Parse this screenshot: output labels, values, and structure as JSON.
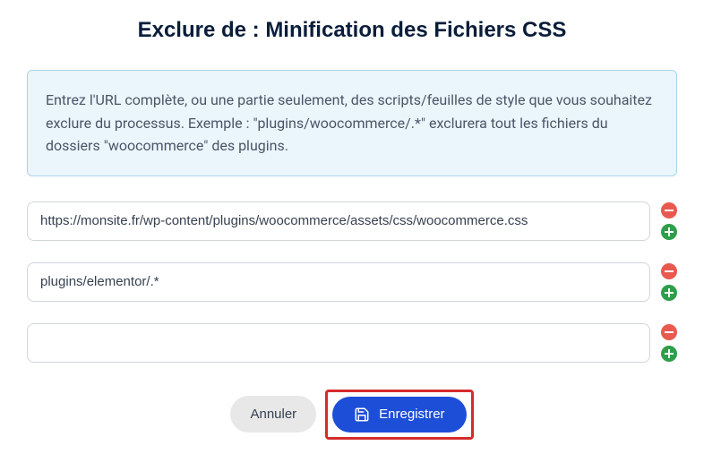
{
  "title": "Exclure de : Minification des Fichiers CSS",
  "info_text": "Entrez l'URL complète, ou une partie seulement, des scripts/feuilles de style que vous souhaitez exclure du processus. Exemple : \"plugins/woocommerce/.*\" exclurera tout les fichiers du dossiers \"woocommerce\" des plugins.",
  "rows": [
    {
      "value": "https://monsite.fr/wp-content/plugins/woocommerce/assets/css/woocommerce.css"
    },
    {
      "value": "plugins/elementor/.*"
    },
    {
      "value": ""
    }
  ],
  "buttons": {
    "cancel": "Annuler",
    "save": "Enregistrer"
  }
}
